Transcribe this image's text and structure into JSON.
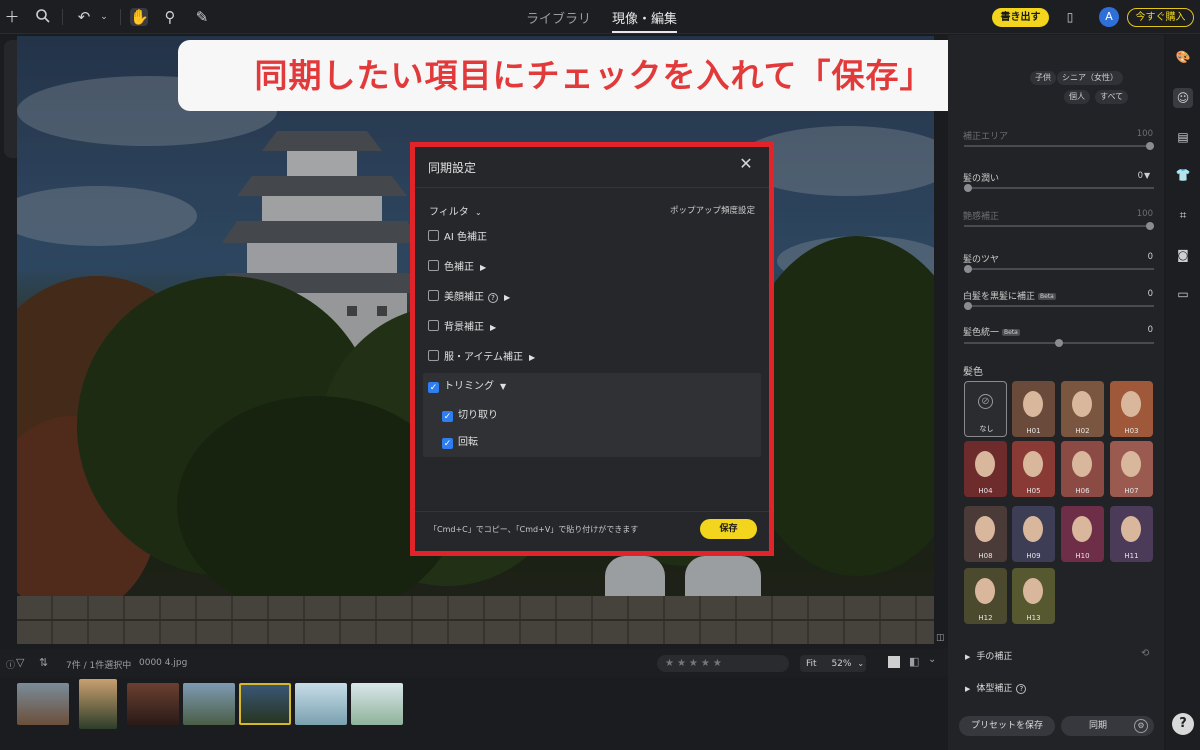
{
  "topbar": {
    "tabs": [
      "ライブラリ",
      "現像・編集"
    ],
    "export_label": "書き出す",
    "avatar_initial": "A",
    "buy_label": "今すぐ購入"
  },
  "banner": {
    "text": "同期したい項目にチェックを入れて「保存」"
  },
  "modal": {
    "title": "同期設定",
    "filter_label": "フィルタ",
    "popup_label": "ポップアップ頻度設定",
    "items": [
      {
        "label": "AI 色補正",
        "checked": false
      },
      {
        "label": "色補正",
        "checked": false
      },
      {
        "label": "美顔補正",
        "checked": false
      },
      {
        "label": "背景補正",
        "checked": false
      },
      {
        "label": "服・アイテム補正",
        "checked": false
      },
      {
        "label": "トリミング",
        "checked": true
      },
      {
        "label": "切り取り",
        "checked": true
      },
      {
        "label": "回転",
        "checked": true
      }
    ],
    "hint": "「Cmd+C」でコピー、「Cmd+V」で貼り付けができます",
    "save_label": "保存",
    "close_glyph": "✕"
  },
  "right_panel": {
    "chips": [
      "子供",
      "シニア（女性）",
      "個人",
      "すべて"
    ],
    "sliders": [
      {
        "label": "補正エリア",
        "value": "100",
        "dim": true
      },
      {
        "label": "髪の潤い",
        "value": "0",
        "dim": false
      },
      {
        "label": "艶感補正",
        "value": "100",
        "dim": true
      },
      {
        "label": "髪のツヤ",
        "value": "0",
        "dim": false
      },
      {
        "label": "白髪を黒髪に補正",
        "value": "0",
        "dim": false
      },
      {
        "label": "髪色統一",
        "value": "0",
        "dim": false
      }
    ],
    "beta_label": "Beta",
    "hair_color_label": "髪色",
    "none_label": "なし",
    "swatches": [
      "H01",
      "H02",
      "H03",
      "H04",
      "H05",
      "H06",
      "H07",
      "H08",
      "H09",
      "H10",
      "H11",
      "H12",
      "H13"
    ],
    "section_hand": "手の補正",
    "section_body": "体型補正",
    "preset_label": "プリセットを保存",
    "sync_label": "同期"
  },
  "filmbar": {
    "count_text": "7件 / 1件選択中",
    "file_name": "0000 4.jpg",
    "fit_label": "Fit",
    "zoom_label": "52%"
  },
  "colors": {
    "accent_yellow": "#f2d51c",
    "highlight_red": "#e1242a",
    "banner_text_red": "#e23a3a",
    "checkbox_blue": "#2f7df0"
  }
}
